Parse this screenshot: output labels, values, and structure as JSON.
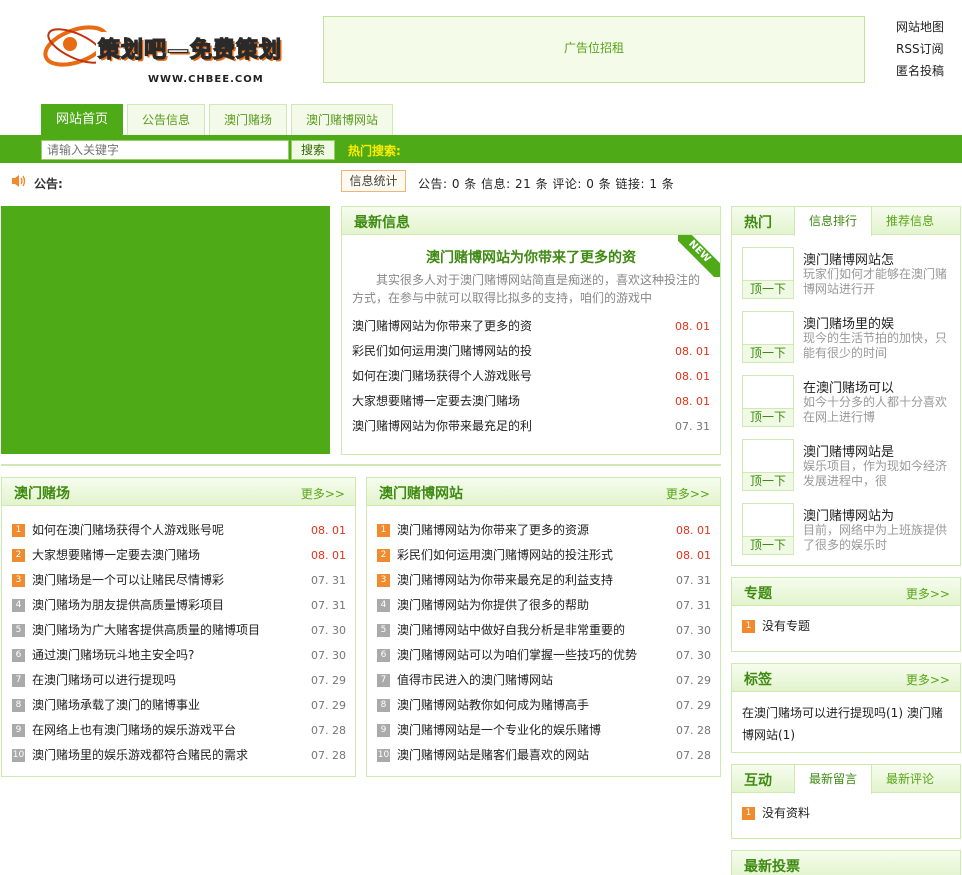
{
  "header": {
    "logo_text": "策划吧—免费策划",
    "logo_sub": "WWW.CHBEE.COM",
    "ad_text": "广告位招租",
    "links": [
      "网站地图",
      "RSS订阅",
      "匿名投稿"
    ]
  },
  "nav": {
    "tabs": [
      {
        "label": "网站首页",
        "active": true
      },
      {
        "label": "公告信息",
        "active": false
      },
      {
        "label": "澳门赌场",
        "active": false
      },
      {
        "label": "澳门赌博网站",
        "active": false
      }
    ]
  },
  "search": {
    "placeholder": "请输入关键字",
    "button": "搜索",
    "hot_label": "热门搜索:"
  },
  "notice": {
    "label": "公告:",
    "stats_tab": "信息统计",
    "stats_text": "公告: 0 条 信息: 21 条 评论: 0 条 链接: 1 条"
  },
  "latest": {
    "title": "最新信息",
    "badge": "NEW",
    "feature_title": "澳门赌博网站为你带来了更多的资",
    "feature_desc": "其实很多人对于澳门赌博网站简直是痴迷的，喜欢这种投注的方式，在参与中就可以取得比拟多的支持，咱们的游戏中",
    "items": [
      {
        "title": "澳门赌博网站为你带来了更多的资",
        "date": "08. 01",
        "hot": true
      },
      {
        "title": "彩民们如何运用澳门赌博网站的投",
        "date": "08. 01",
        "hot": true
      },
      {
        "title": "如何在澳门赌场获得个人游戏账号",
        "date": "08. 01",
        "hot": true
      },
      {
        "title": "大家想要赌博一定要去澳门赌场",
        "date": "08. 01",
        "hot": true
      },
      {
        "title": "澳门赌博网站为你带来最充足的利",
        "date": "07. 31",
        "hot": false
      }
    ]
  },
  "casino": {
    "title": "澳门赌场",
    "more": "更多>>",
    "items": [
      {
        "n": "1",
        "title": "如何在澳门赌场获得个人游戏账号呢",
        "date": "08. 01",
        "hot": true
      },
      {
        "n": "2",
        "title": "大家想要赌博一定要去澳门赌场",
        "date": "08. 01",
        "hot": true
      },
      {
        "n": "3",
        "title": "澳门赌场是一个可以让赌民尽情博彩",
        "date": "07. 31",
        "hot": false
      },
      {
        "n": "4",
        "title": "澳门赌场为朋友提供高质量博彩项目",
        "date": "07. 31",
        "hot": false
      },
      {
        "n": "5",
        "title": "澳门赌场为广大赌客提供高质量的赌博项目",
        "date": "07. 30",
        "hot": false
      },
      {
        "n": "6",
        "title": "通过澳门赌场玩斗地主安全吗?",
        "date": "07. 30",
        "hot": false
      },
      {
        "n": "7",
        "title": "在澳门赌场可以进行提现吗",
        "date": "07. 29",
        "hot": false
      },
      {
        "n": "8",
        "title": "澳门赌场承载了澳门的赌博事业",
        "date": "07. 29",
        "hot": false
      },
      {
        "n": "9",
        "title": "在网络上也有澳门赌场的娱乐游戏平台",
        "date": "07. 28",
        "hot": false
      },
      {
        "n": "10",
        "title": "澳门赌场里的娱乐游戏都符合赌民的需求",
        "date": "07. 28",
        "hot": false
      }
    ]
  },
  "casino_site": {
    "title": "澳门赌博网站",
    "more": "更多>>",
    "items": [
      {
        "n": "1",
        "title": "澳门赌博网站为你带来了更多的资源",
        "date": "08. 01",
        "hot": true
      },
      {
        "n": "2",
        "title": "彩民们如何运用澳门赌博网站的投注形式",
        "date": "08. 01",
        "hot": true
      },
      {
        "n": "3",
        "title": "澳门赌博网站为你带来最充足的利益支持",
        "date": "07. 31",
        "hot": false
      },
      {
        "n": "4",
        "title": "澳门赌博网站为你提供了很多的帮助",
        "date": "07. 31",
        "hot": false
      },
      {
        "n": "5",
        "title": "澳门赌博网站中做好自我分析是非常重要的",
        "date": "07. 30",
        "hot": false
      },
      {
        "n": "6",
        "title": "澳门赌博网站可以为咱们掌握一些技巧的优势",
        "date": "07. 30",
        "hot": false
      },
      {
        "n": "7",
        "title": "值得市民进入的澳门赌博网站",
        "date": "07. 29",
        "hot": false
      },
      {
        "n": "8",
        "title": "澳门赌博网站教你如何成为赌博高手",
        "date": "07. 29",
        "hot": false
      },
      {
        "n": "9",
        "title": "澳门赌博网站是一个专业化的娱乐赌博",
        "date": "07. 28",
        "hot": false
      },
      {
        "n": "10",
        "title": "澳门赌博网站是赌客们最喜欢的网站",
        "date": "07. 28",
        "hot": false
      }
    ]
  },
  "hot": {
    "title": "热门",
    "tabs": [
      "信息排行",
      "推荐信息"
    ],
    "ding": "顶一下",
    "items": [
      {
        "title": "澳门赌博网站怎",
        "desc": "玩家们如何才能够在澳门赌博网站进行开"
      },
      {
        "title": "澳门赌场里的娱",
        "desc": "现今的生活节拍的加快，只能有很少的时间"
      },
      {
        "title": "在澳门赌场可以",
        "desc": "如今十分多的人都十分喜欢在网上进行博"
      },
      {
        "title": "澳门赌博网站是",
        "desc": "娱乐项目，作为现如今经济发展进程中，很"
      },
      {
        "title": "澳门赌博网站为",
        "desc": "目前，网络中为上班族提供了很多的娱乐时"
      }
    ]
  },
  "topic": {
    "title": "专题",
    "more": "更多>>",
    "item": "没有专题"
  },
  "tags": {
    "title": "标签",
    "more": "更多>>",
    "text": "在澳门赌场可以进行提现吗(1) 澳门赌博网站(1)"
  },
  "interact": {
    "title": "互动",
    "tabs": [
      "最新留言",
      "最新评论"
    ],
    "item": "没有资料"
  },
  "vote": {
    "title": "最新投票"
  }
}
